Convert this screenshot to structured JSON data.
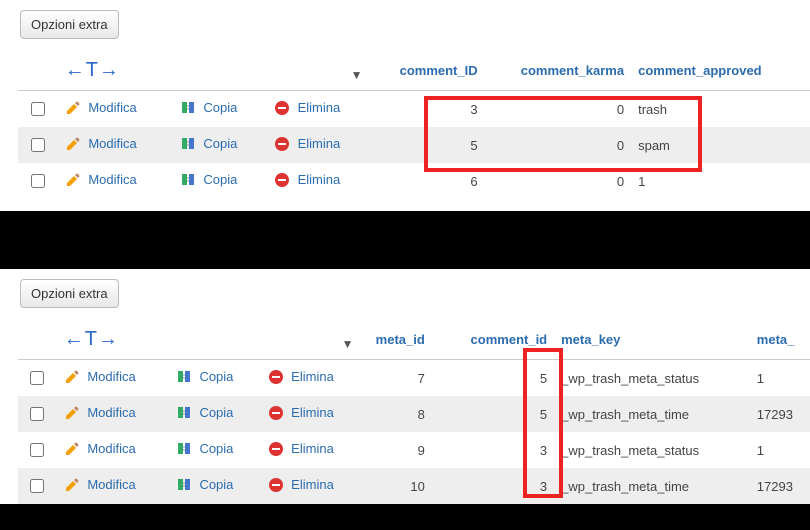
{
  "buttons": {
    "extra_options": "Opzioni extra"
  },
  "actions": {
    "edit": "Modifica",
    "copy": "Copia",
    "delete": "Elimina"
  },
  "table1": {
    "columns": {
      "comment_id": "comment_ID",
      "comment_karma": "comment_karma",
      "comment_approved": "comment_approved"
    },
    "rows": [
      {
        "comment_id": "3",
        "comment_karma": "0",
        "comment_approved": "trash"
      },
      {
        "comment_id": "5",
        "comment_karma": "0",
        "comment_approved": "spam"
      },
      {
        "comment_id": "6",
        "comment_karma": "0",
        "comment_approved": "1"
      }
    ]
  },
  "table2": {
    "columns": {
      "meta_id": "meta_id",
      "comment_id": "comment_id",
      "meta_key": "meta_key",
      "meta_partial": "meta_"
    },
    "rows": [
      {
        "meta_id": "7",
        "comment_id": "5",
        "meta_key": "_wp_trash_meta_status",
        "meta_v": "1"
      },
      {
        "meta_id": "8",
        "comment_id": "5",
        "meta_key": "_wp_trash_meta_time",
        "meta_v": "17293"
      },
      {
        "meta_id": "9",
        "comment_id": "3",
        "meta_key": "_wp_trash_meta_status",
        "meta_v": "1"
      },
      {
        "meta_id": "10",
        "comment_id": "3",
        "meta_key": "_wp_trash_meta_time",
        "meta_v": "17293"
      }
    ]
  }
}
